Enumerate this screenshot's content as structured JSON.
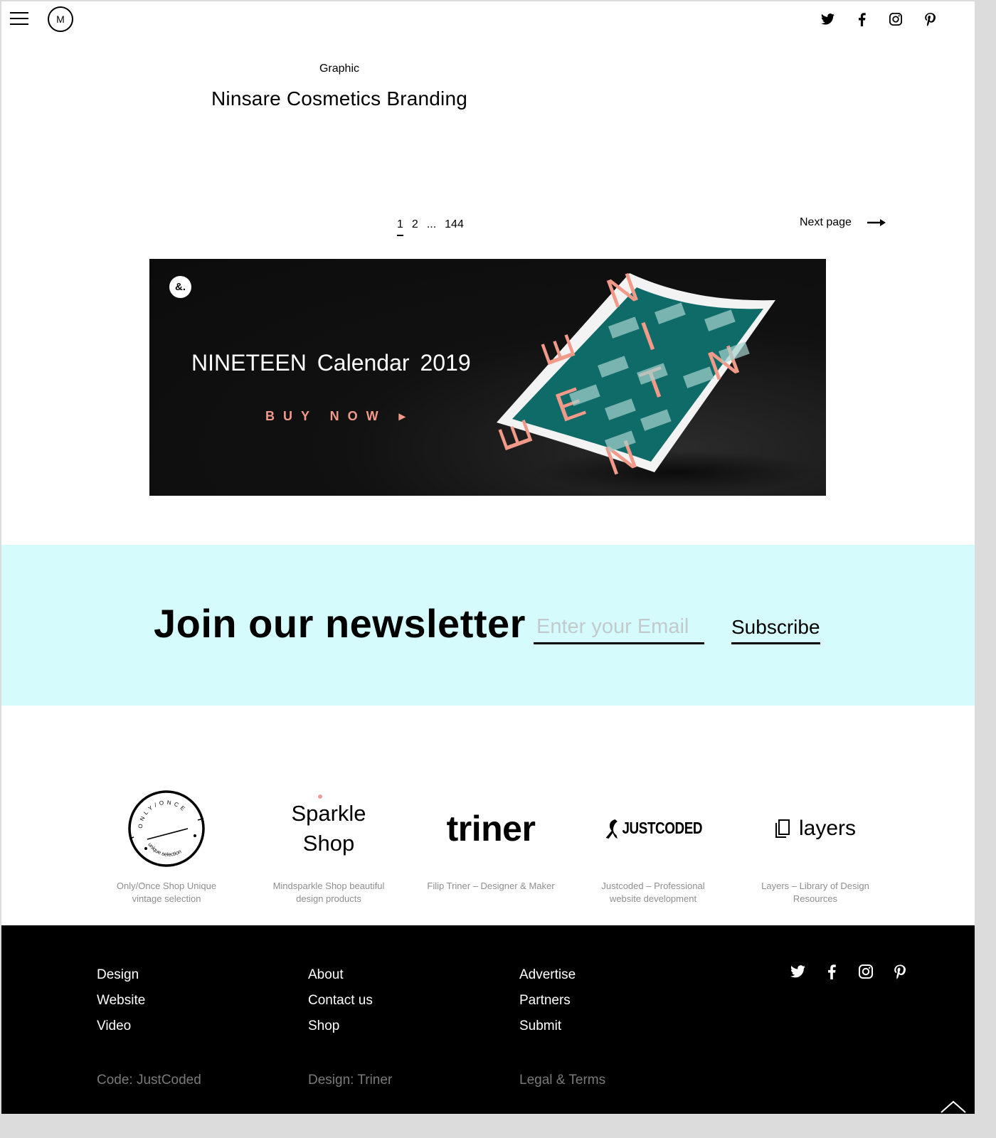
{
  "header": {
    "menu_icon": "hamburger-menu-icon",
    "logo_text": "M",
    "social": [
      "twitter-icon",
      "facebook-icon",
      "instagram-icon",
      "pinterest-icon"
    ]
  },
  "post": {
    "category": "Graphic",
    "title": "Ninsare Cosmetics Branding"
  },
  "pagination": {
    "pages": [
      "1",
      "2",
      "...",
      "144"
    ],
    "current": "1",
    "next_label": "Next page"
  },
  "banner": {
    "badge": "&.",
    "title": "NINETEEN  Calendar 2019",
    "cta": "BUY NOW ▸",
    "accent_color": "#f29a8a",
    "poster_color": "#0f6b68",
    "poster_letters": [
      "N",
      "I",
      "N",
      "E",
      "T",
      "E",
      "E",
      "N"
    ]
  },
  "newsletter": {
    "title": "Join our newsletter",
    "email_placeholder": "Enter your Email",
    "email_value": "",
    "subscribe_label": "Subscribe",
    "bg_color": "#d6fbfc"
  },
  "partners": [
    {
      "logo": "ONLY/ONCE unique selection",
      "desc": "Only/Once Shop Unique vintage selection"
    },
    {
      "logo": "Sparkle Shop",
      "desc": "Mindsparkle Shop beautiful design products"
    },
    {
      "logo": "triner",
      "desc": "Filip Triner – Designer & Maker"
    },
    {
      "logo": "JUSTCODED",
      "desc": "Justcoded – Professional website development"
    },
    {
      "logo": "layers",
      "desc": "Layers – Library of Design Resources"
    }
  ],
  "footer": {
    "col1": [
      "Design",
      "Website",
      "Video"
    ],
    "col2": [
      "About",
      "Contact us",
      "Shop"
    ],
    "col3": [
      "Advertise",
      "Partners",
      "Submit"
    ],
    "credits": {
      "code": "Code: JustCoded",
      "design": "Design: Triner",
      "legal": "Legal & Terms"
    },
    "social": [
      "twitter-icon",
      "facebook-icon",
      "instagram-icon",
      "pinterest-icon"
    ],
    "back_to_top_icon": "chevron-up-icon"
  }
}
